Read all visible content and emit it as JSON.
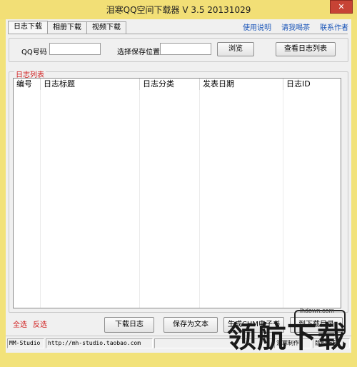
{
  "window": {
    "title": "泪寒QQ空间下载器 V 3.5 20131029",
    "close_label": "✕"
  },
  "tabs": [
    {
      "label": "日志下载",
      "active": true
    },
    {
      "label": "相册下载",
      "active": false
    },
    {
      "label": "视频下载",
      "active": false
    }
  ],
  "top_links": [
    "使用说明",
    "请我喝茶",
    "联系作者"
  ],
  "settings": {
    "qq_label": "QQ号码",
    "qq_value": "",
    "save_label": "选择保存位置",
    "save_value": "",
    "browse_button": "浏览",
    "view_list_button": "查看日志列表"
  },
  "log_list": {
    "group_title": "日志列表",
    "columns": [
      "编号",
      "日志标题",
      "日志分类",
      "发表日期",
      "日志ID"
    ]
  },
  "bottom": {
    "select_all": "全选",
    "invert_select": "反选",
    "download_button": "下载日志",
    "save_text_button": "保存为文本",
    "chm_button": "生成CHM电子书",
    "goto_dir_button": "到下载目录"
  },
  "statusbar": {
    "cells": [
      "MM-Studio",
      "http://mh-studio.taobao.com",
      "",
      "泪寒制作",
      "版权所有"
    ]
  },
  "watermark": {
    "text": "领航下载",
    "url": "lhdown.com"
  },
  "colors": {
    "frame": "#f2df76",
    "accent_red": "#d01a1a",
    "link_blue": "#1a55b8"
  }
}
